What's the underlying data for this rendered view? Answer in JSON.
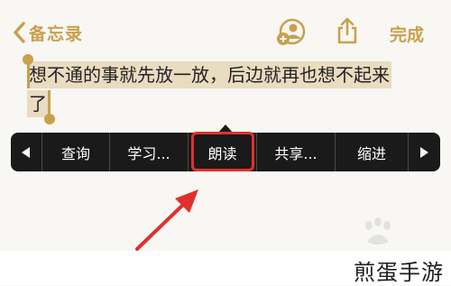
{
  "nav": {
    "back_label": "备忘录",
    "done_label": "完成"
  },
  "note": {
    "line1": "想不通的事就先放一放，后边就再也想不起来",
    "line2": "了"
  },
  "menu": {
    "items": [
      "查询",
      "学习...",
      "朗读",
      "共享...",
      "缩进"
    ],
    "highlighted": "朗读"
  },
  "footer": {
    "brand": "煎蛋手游"
  },
  "colors": {
    "accent": "#c9a04f",
    "menu_bg": "#1a1a1a",
    "highlight": "#e1302c"
  }
}
